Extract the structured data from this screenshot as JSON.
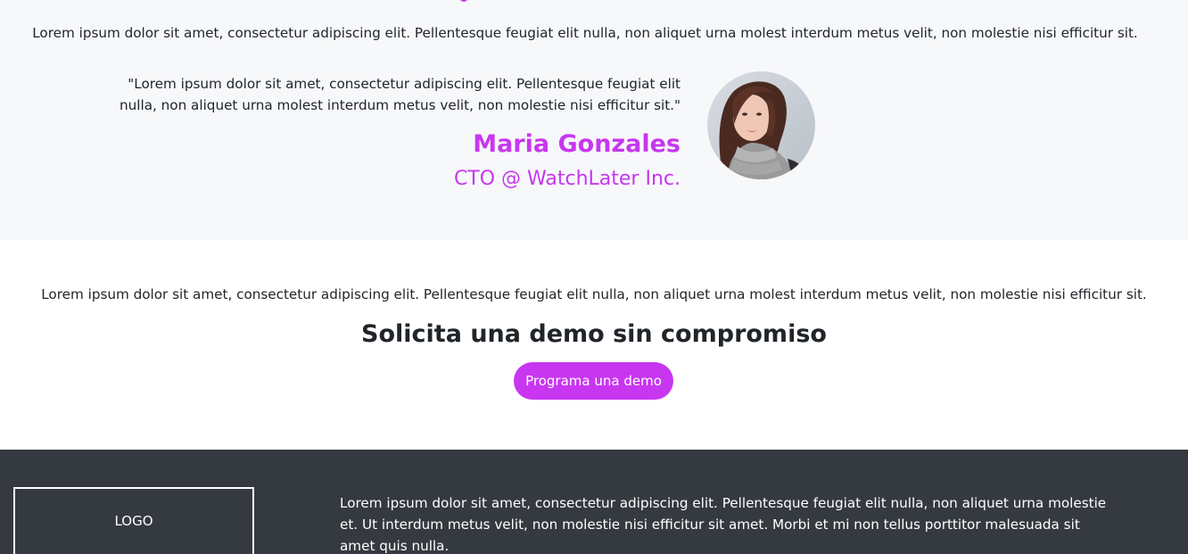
{
  "testimonial": {
    "intro": "Lorem ipsum dolor sit amet, consectetur adipiscing elit. Pellentesque feugiat elit nulla, non aliquet urna molest interdum metus velit, non molestie nisi efficitur sit.",
    "quote": "\"Lorem ipsum dolor sit amet, consectetur adipiscing elit. Pellentesque feugiat elit nulla, non aliquet urna molest interdum metus velit, non molestie nisi efficitur sit.\"",
    "author_name": "Maria Gonzales",
    "author_role": "CTO @ WatchLater Inc."
  },
  "cta": {
    "text": "Lorem ipsum dolor sit amet, consectetur adipiscing elit. Pellentesque feugiat elit nulla, non aliquet urna molest interdum metus velit, non molestie nisi efficitur sit.",
    "heading": "Solicita una demo sin compromiso",
    "button_label": "Programa una demo"
  },
  "footer": {
    "logo": "LOGO",
    "text": "Lorem ipsum dolor sit amet, consectetur adipiscing elit. Pellentesque feugiat elit nulla, non aliquet urna molestie et. Ut interdum metus velit, non molestie nisi efficitur sit amet. Morbi et mi non tellus porttitor malesuada sit amet quis nulla."
  },
  "colors": {
    "accent": "#c836f0",
    "section_bg": "#f7f8fa",
    "footer_bg": "#343a40",
    "text": "#212529"
  }
}
